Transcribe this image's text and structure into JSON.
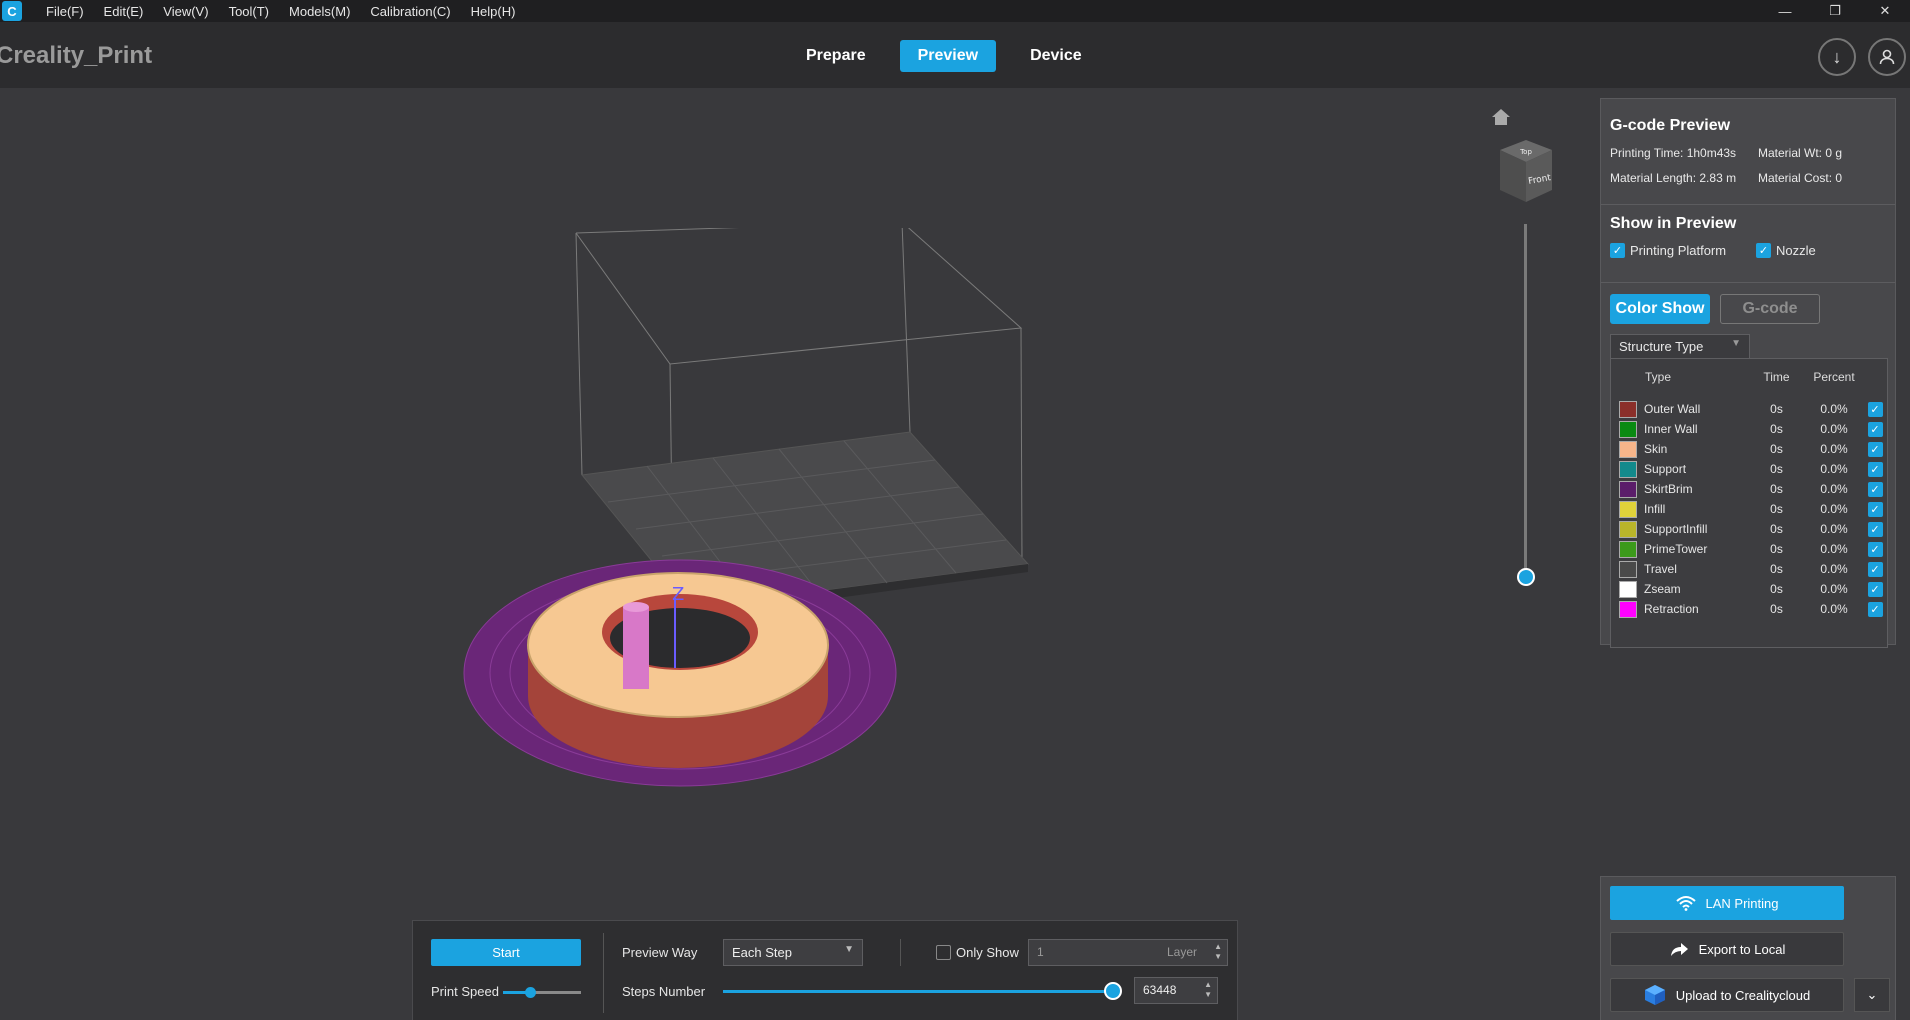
{
  "menubar": {
    "logo_glyph": "C",
    "items": [
      "File(F)",
      "Edit(E)",
      "View(V)",
      "Tool(T)",
      "Models(M)",
      "Calibration(C)",
      "Help(H)"
    ]
  },
  "window_controls": {
    "minimize": "—",
    "restore": "❐",
    "close": "✕"
  },
  "app_title": "Creality_Print",
  "main_tabs": [
    {
      "label": "Prepare",
      "active": false
    },
    {
      "label": "Preview",
      "active": true
    },
    {
      "label": "Device",
      "active": false
    }
  ],
  "top_right": {
    "download_icon": "↓",
    "account_icon": "👤"
  },
  "view_cube": {
    "top": "Top",
    "front": "Front"
  },
  "gcode_preview": {
    "title": "G-code Preview",
    "printing_time": "Printing Time: 1h0m43s",
    "material_wt": "Material Wt: 0 g",
    "material_length": "Material Length: 2.83 m",
    "material_cost": "Material Cost: 0"
  },
  "show_in_preview": {
    "title": "Show in Preview",
    "printing_platform": {
      "label": "Printing Platform",
      "checked": true
    },
    "nozzle": {
      "label": "Nozzle",
      "checked": true
    }
  },
  "mode_buttons": {
    "color_show": "Color Show",
    "gcode": "G-code"
  },
  "structure_select": {
    "value": "Structure Type"
  },
  "type_table": {
    "headers": {
      "type": "Type",
      "time": "Time",
      "percent": "Percent"
    },
    "rows": [
      {
        "name": "Outer Wall",
        "color": "#8b2f2a",
        "time": "0s",
        "percent": "0.0%",
        "checked": true
      },
      {
        "name": "Inner Wall",
        "color": "#0a8a12",
        "time": "0s",
        "percent": "0.0%",
        "checked": true
      },
      {
        "name": "Skin",
        "color": "#f7b58a",
        "time": "0s",
        "percent": "0.0%",
        "checked": true
      },
      {
        "name": "Support",
        "color": "#138a8c",
        "time": "0s",
        "percent": "0.0%",
        "checked": true
      },
      {
        "name": "SkirtBrim",
        "color": "#5b1d6a",
        "time": "0s",
        "percent": "0.0%",
        "checked": true
      },
      {
        "name": "Infill",
        "color": "#e0d23a",
        "time": "0s",
        "percent": "0.0%",
        "checked": true
      },
      {
        "name": "SupportInfill",
        "color": "#b9b52a",
        "time": "0s",
        "percent": "0.0%",
        "checked": true
      },
      {
        "name": "PrimeTower",
        "color": "#3c9a1b",
        "time": "0s",
        "percent": "0.0%",
        "checked": true
      },
      {
        "name": "Travel",
        "color": "#4a4a4a",
        "time": "0s",
        "percent": "0.0%",
        "checked": true
      },
      {
        "name": "Zseam",
        "color": "#ffffff",
        "time": "0s",
        "percent": "0.0%",
        "checked": true
      },
      {
        "name": "Retraction",
        "color": "#ff00ff",
        "time": "0s",
        "percent": "0.0%",
        "checked": true
      }
    ]
  },
  "bottom_bar": {
    "start_label": "Start",
    "print_speed_label": "Print Speed",
    "print_speed_fraction": 0.35,
    "preview_way_label": "Preview Way",
    "preview_way_value": "Each Step",
    "only_show_label": "Only Show",
    "only_show_checked": false,
    "layer_value": "1",
    "layer_suffix": "Layer",
    "steps_number_label": "Steps Number",
    "steps_fraction": 1.0,
    "steps_value": "63448"
  },
  "export_panel": {
    "lan_printing": "LAN Printing",
    "export_local": "Export to Local",
    "upload_cloud": "Upload to Crealitycloud"
  },
  "layer_slider_fraction": 0.0,
  "colors": {
    "accent": "#1ba3e0"
  }
}
